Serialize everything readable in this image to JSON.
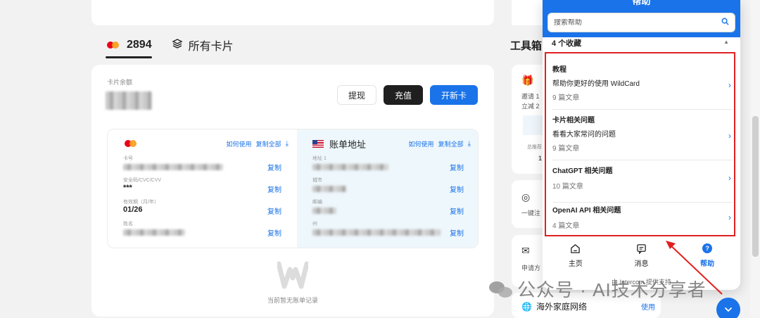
{
  "card_tabs": [
    {
      "label": "2894",
      "active": true,
      "icon": "mastercard-icon"
    },
    {
      "label": "所有卡片",
      "active": false,
      "icon": "layers-icon"
    }
  ],
  "balance": {
    "label": "卡片余额"
  },
  "actions": {
    "withdraw": "提现",
    "top_up": "充值",
    "open_card": "开新卡"
  },
  "card_info": {
    "links": {
      "how_to_use": "如何使用",
      "copy_all": "复制全部"
    },
    "fields": [
      {
        "label": "卡号",
        "value": "",
        "copy": "复制"
      },
      {
        "label": "安全码/CVC/CVV",
        "value": "***",
        "copy": "复制"
      },
      {
        "label": "有效期（月/年）",
        "value": "01/26",
        "copy": "复制"
      },
      {
        "label": "姓名",
        "value": "",
        "copy": "复制"
      }
    ]
  },
  "billing": {
    "title": "账单地址",
    "links": {
      "how_to_use": "如何使用",
      "copy_all": "复制全部"
    },
    "fields": [
      {
        "label": "地址 1",
        "copy": "复制"
      },
      {
        "label": "城市",
        "copy": "复制"
      },
      {
        "label": "邮编",
        "copy": "复制"
      },
      {
        "label": "州",
        "copy": "复制"
      }
    ]
  },
  "empty_state": {
    "text": "当前暂无账单记录"
  },
  "tools": {
    "title": "工具箱",
    "card1": {
      "line1": "邀请 1",
      "line2": "立减 2",
      "line3": "总推荐",
      "line4": "1"
    },
    "card2": {
      "line1": "一键注"
    },
    "card3": {
      "line1": "申请方"
    },
    "card4": {
      "title": "海外家庭网络",
      "action": "使用"
    }
  },
  "help": {
    "title": "帮助",
    "search_placeholder": "搜索帮助",
    "favorites": "4 个收藏",
    "collections": [
      {
        "title": "教程",
        "desc": "帮助你更好的使用 WildCard",
        "count": "9 篇文章"
      },
      {
        "title": "卡片相关问题",
        "desc": "看看大家常问的问题",
        "count": "9 篇文章"
      },
      {
        "title": "ChatGPT 相关问题",
        "desc": "",
        "count": "10 篇文章"
      },
      {
        "title": "OpenAI API 相关问题",
        "desc": "",
        "count": "4 篇文章"
      }
    ],
    "nav": [
      {
        "label": "主页",
        "icon": "home-icon"
      },
      {
        "label": "消息",
        "icon": "message-icon"
      },
      {
        "label": "帮助",
        "icon": "help-icon",
        "active": true
      }
    ],
    "footer": "由 Intercom 提供支持"
  },
  "watermark": {
    "text": "公众号 · AI技术分享者"
  },
  "colors": {
    "accent": "#1a73e8",
    "dark_button": "#1f1f1f",
    "annotation": "#e02020"
  }
}
